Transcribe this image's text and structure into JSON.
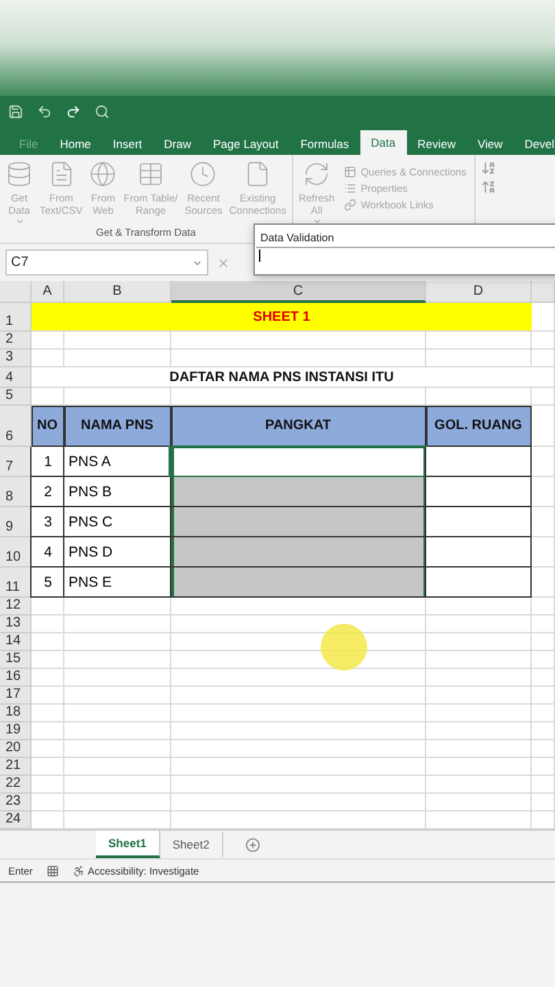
{
  "ribbon_tabs": [
    {
      "label": "File",
      "selected": false
    },
    {
      "label": "Home",
      "selected": false
    },
    {
      "label": "Insert",
      "selected": false
    },
    {
      "label": "Draw",
      "selected": false
    },
    {
      "label": "Page Layout",
      "selected": false
    },
    {
      "label": "Formulas",
      "selected": false
    },
    {
      "label": "Data",
      "selected": true
    },
    {
      "label": "Review",
      "selected": false
    },
    {
      "label": "View",
      "selected": false
    },
    {
      "label": "Devel",
      "selected": false
    }
  ],
  "ribbon_buttons": [
    {
      "kind": "database",
      "lines": [
        "Get",
        "Data"
      ],
      "dropdown": true
    },
    {
      "kind": "text",
      "lines": [
        "From",
        "Text/CSV"
      ],
      "dropdown": false
    },
    {
      "kind": "web",
      "lines": [
        "From",
        "Web"
      ],
      "dropdown": false
    },
    {
      "kind": "table",
      "lines": [
        "From Table/",
        "Range"
      ],
      "dropdown": false
    },
    {
      "kind": "recent",
      "lines": [
        "Recent",
        "Sources"
      ],
      "dropdown": false
    },
    {
      "kind": "connections",
      "lines": [
        "Existing",
        "Connections"
      ],
      "dropdown": false
    }
  ],
  "group_label": "Get & Transform Data",
  "refresh_button": {
    "lines": [
      "Refresh",
      "All"
    ],
    "dropdown": true
  },
  "query_links": [
    {
      "kind": "queries",
      "label": "Queries & Connections"
    },
    {
      "kind": "properties",
      "label": "Properties"
    },
    {
      "kind": "links",
      "label": "Workbook Links"
    }
  ],
  "name_box": "C7",
  "dialog": {
    "title": "Data Validation"
  },
  "columns": [
    {
      "label": "A",
      "selected": false
    },
    {
      "label": "B",
      "selected": false
    },
    {
      "label": "C",
      "selected": true
    },
    {
      "label": "D",
      "selected": false
    }
  ],
  "rows": [
    {
      "number": "1",
      "kind": "title",
      "text": "SHEET 1"
    },
    {
      "number": "2",
      "kind": "blank"
    },
    {
      "number": "3",
      "kind": "blank"
    },
    {
      "number": "4",
      "kind": "heading",
      "text": "DAFTAR NAMA PNS INSTANSI ITU"
    },
    {
      "number": "5",
      "kind": "blank"
    },
    {
      "number": "6",
      "kind": "header",
      "cells": [
        "NO",
        "NAMA PNS",
        "PANGKAT",
        "GOL. RUANG"
      ]
    },
    {
      "number": "7",
      "kind": "data",
      "no": "1",
      "name": "PNS A",
      "selected": true,
      "active": true
    },
    {
      "number": "8",
      "kind": "data",
      "no": "2",
      "name": "PNS B",
      "selected": true,
      "active": false
    },
    {
      "number": "9",
      "kind": "data",
      "no": "3",
      "name": "PNS C",
      "selected": true,
      "active": false
    },
    {
      "number": "10",
      "kind": "data",
      "no": "4",
      "name": "PNS D",
      "selected": true,
      "active": false
    },
    {
      "number": "11",
      "kind": "data",
      "no": "5",
      "name": "PNS E",
      "selected": true,
      "active": false
    },
    {
      "number": "12",
      "kind": "blank"
    },
    {
      "number": "13",
      "kind": "blank"
    },
    {
      "number": "14",
      "kind": "blank"
    },
    {
      "number": "15",
      "kind": "blank"
    },
    {
      "number": "16",
      "kind": "blank"
    },
    {
      "number": "17",
      "kind": "blank"
    },
    {
      "number": "18",
      "kind": "blank"
    },
    {
      "number": "19",
      "kind": "blank"
    },
    {
      "number": "20",
      "kind": "blank"
    },
    {
      "number": "21",
      "kind": "blank"
    },
    {
      "number": "22",
      "kind": "blank"
    },
    {
      "number": "23",
      "kind": "blank"
    },
    {
      "number": "24",
      "kind": "blank"
    }
  ],
  "sheet_tabs": [
    {
      "label": "Sheet1",
      "selected": true
    },
    {
      "label": "Sheet2",
      "selected": false
    }
  ],
  "status_bar": {
    "mode": "Enter",
    "accessibility": "Accessibility: Investigate"
  }
}
